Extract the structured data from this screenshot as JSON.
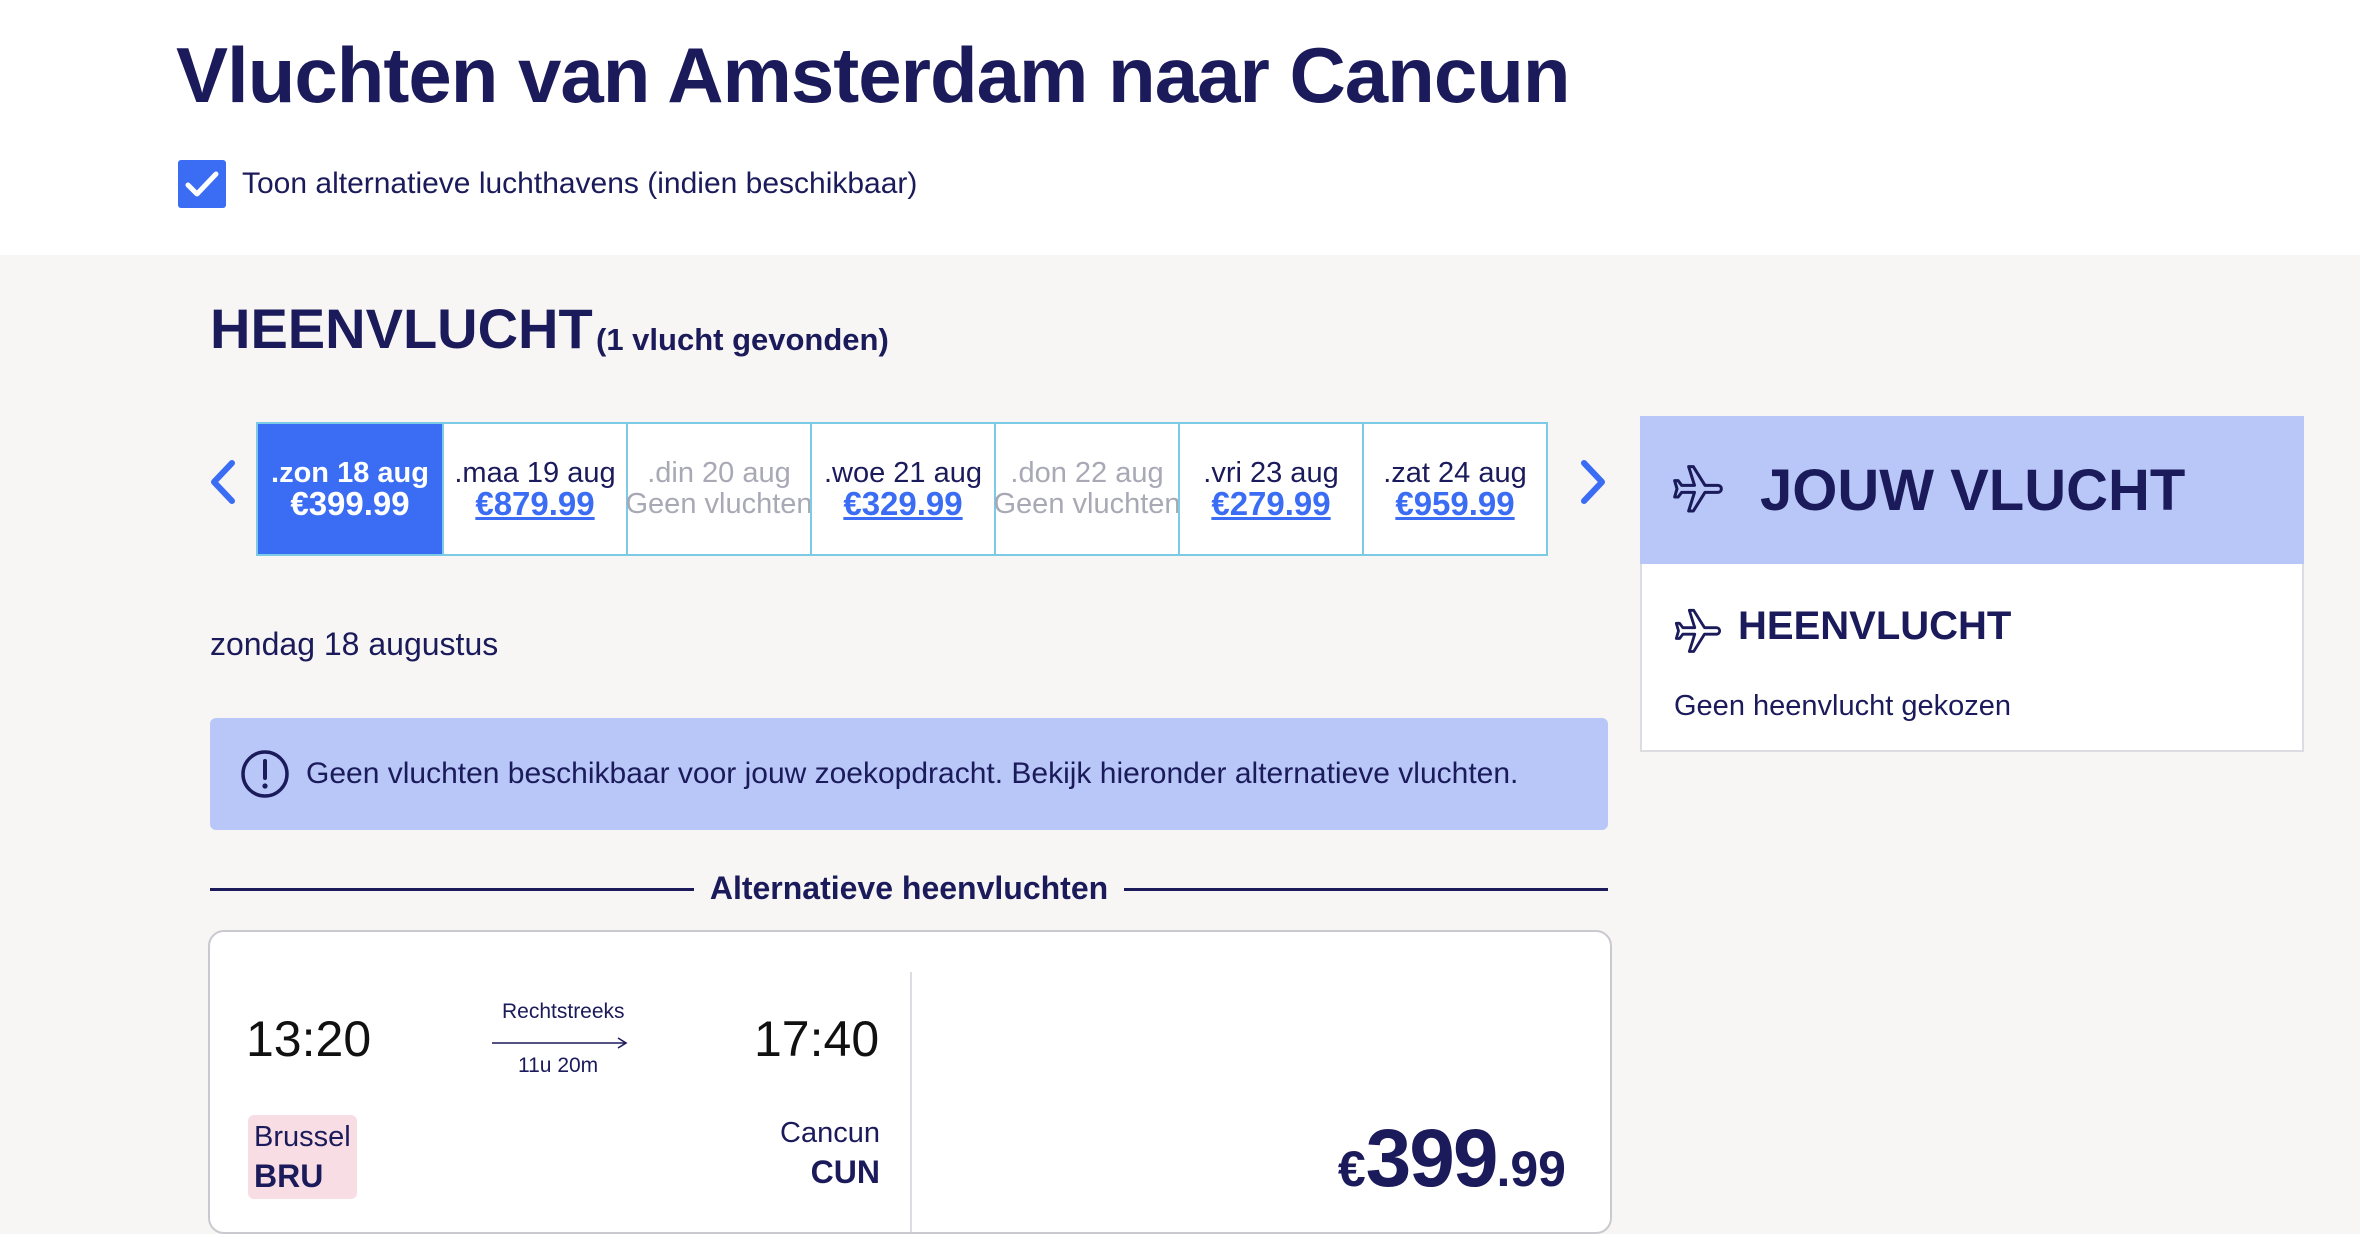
{
  "page": {
    "title": "Vluchten van Amsterdam naar Cancun",
    "alt_airports_label": "Toon alternatieve luchthavens (indien beschikbaar)",
    "alt_airports_checked": true
  },
  "outbound": {
    "heading": "HEENVLUCHT",
    "count": "(1 vlucht gevonden)",
    "dates": [
      {
        "day": ".zon 18 aug",
        "price": "€399.99",
        "state": "selected"
      },
      {
        "day": ".maa 19 aug",
        "price": "€879.99",
        "state": "available"
      },
      {
        "day": ".din 20 aug",
        "price": "Geen vluchten",
        "state": "disabled"
      },
      {
        "day": ".woe 21 aug",
        "price": "€329.99",
        "state": "available"
      },
      {
        "day": ".don 22 aug",
        "price": "Geen vluchten",
        "state": "disabled"
      },
      {
        "day": ".vri 23 aug",
        "price": "€279.99",
        "state": "available"
      },
      {
        "day": ".zat 24 aug",
        "price": "€959.99",
        "state": "available"
      }
    ],
    "selected_date_label": "zondag 18 augustus",
    "notice": "Geen vluchten beschikbaar voor jouw zoekopdracht. Bekijk hieronder alternatieve vluchten.",
    "alternatives_heading": "Alternatieve heenvluchten"
  },
  "flight": {
    "departure_time": "13:20",
    "arrival_time": "17:40",
    "type": "Rechtstreeks",
    "duration": "11u 20m",
    "origin_city": "Brussel",
    "origin_code": "BRU",
    "dest_city": "Cancun",
    "dest_code": "CUN",
    "price_currency": "€",
    "price_int": "399",
    "price_dec": ".99"
  },
  "panel": {
    "title": "JOUW VLUCHT",
    "section": "HEENVLUCHT",
    "status": "Geen heenvlucht gekozen"
  },
  "colors": {
    "accent": "#3a6cf4",
    "navy": "#1b1a5a",
    "notice_bg": "#b8c7f7",
    "cell_border": "#7ccbe6",
    "origin_badge": "#f9dde5"
  },
  "icons": [
    "check-icon",
    "chevron-left-icon",
    "chevron-right-icon",
    "exclamation-circle-icon",
    "plane-icon",
    "arrow-right-icon"
  ]
}
